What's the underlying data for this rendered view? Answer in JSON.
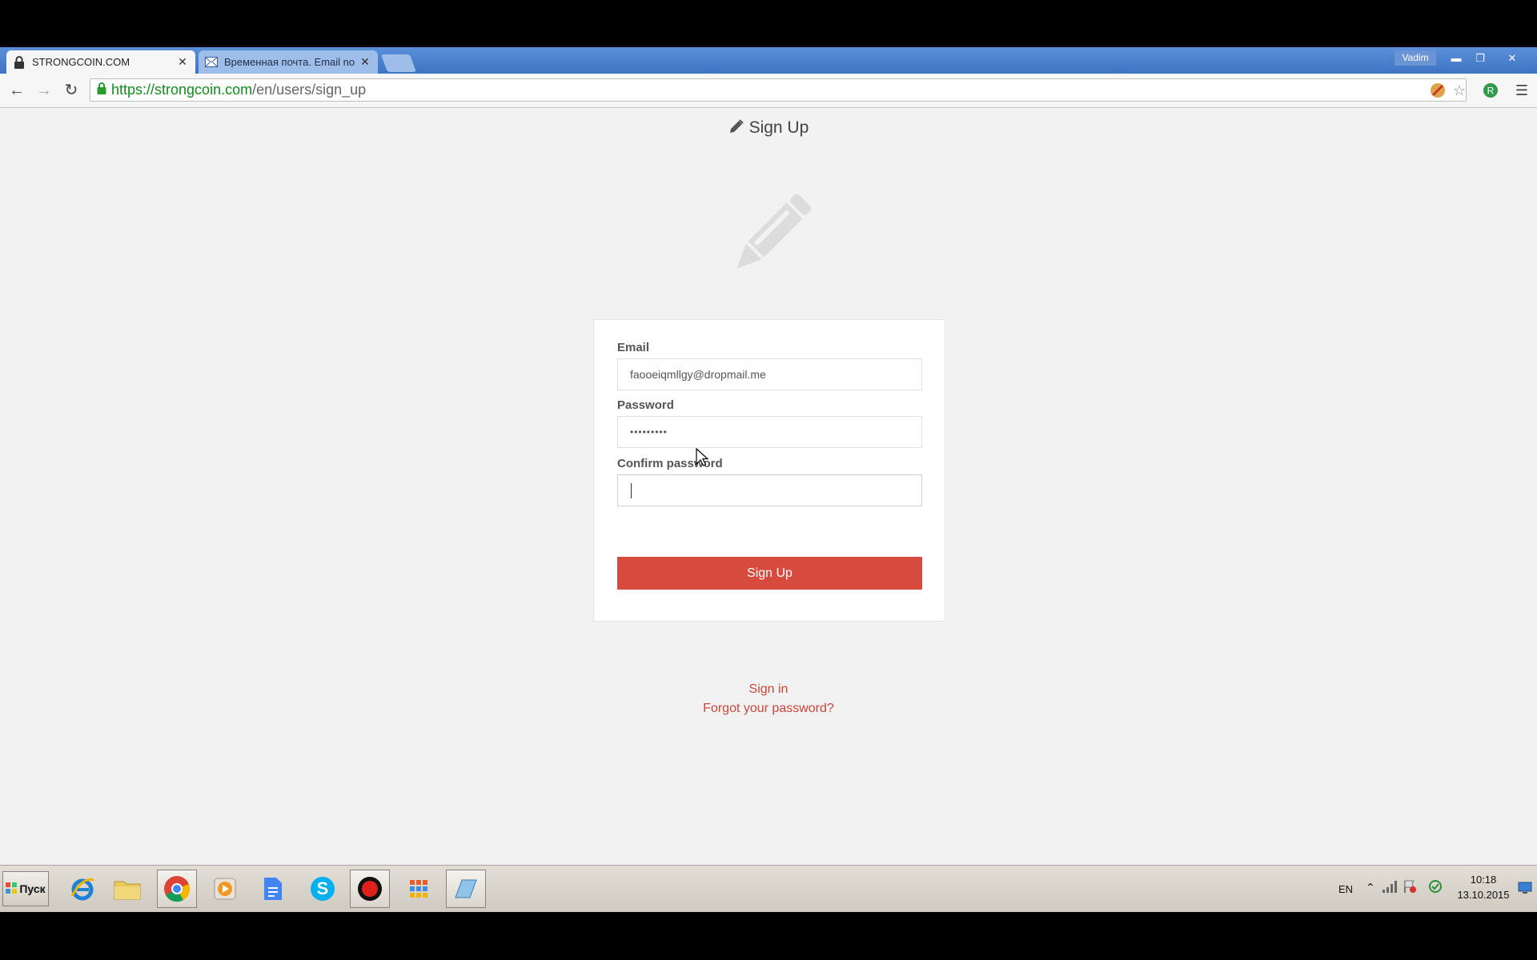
{
  "browser": {
    "tabs": [
      {
        "title": "STRONGCOIN.COM",
        "icon": "lock-icon",
        "active": true
      },
      {
        "title": "Временная почта. Email no",
        "icon": "mail-icon",
        "active": false
      }
    ],
    "user": "Vadim",
    "url": {
      "host": "https://strongcoin.com",
      "path": "/en/users/sign_up"
    }
  },
  "page": {
    "title": "Sign Up",
    "form": {
      "email_label": "Email",
      "email_value": "faooeiqmllgy@dropmail.me",
      "password_label": "Password",
      "password_value": "•••••••••",
      "confirm_label": "Confirm password",
      "confirm_value": "",
      "submit_label": "Sign Up"
    },
    "links": {
      "sign_in": "Sign in",
      "forgot": "Forgot your password?"
    }
  },
  "taskbar": {
    "start_label": "Пуск",
    "lang": "EN",
    "time": "10:18",
    "date": "13.10.2015"
  },
  "colors": {
    "accent": "#d74b3f",
    "link": "#c9463b",
    "tabbar": "#3f74c4"
  }
}
